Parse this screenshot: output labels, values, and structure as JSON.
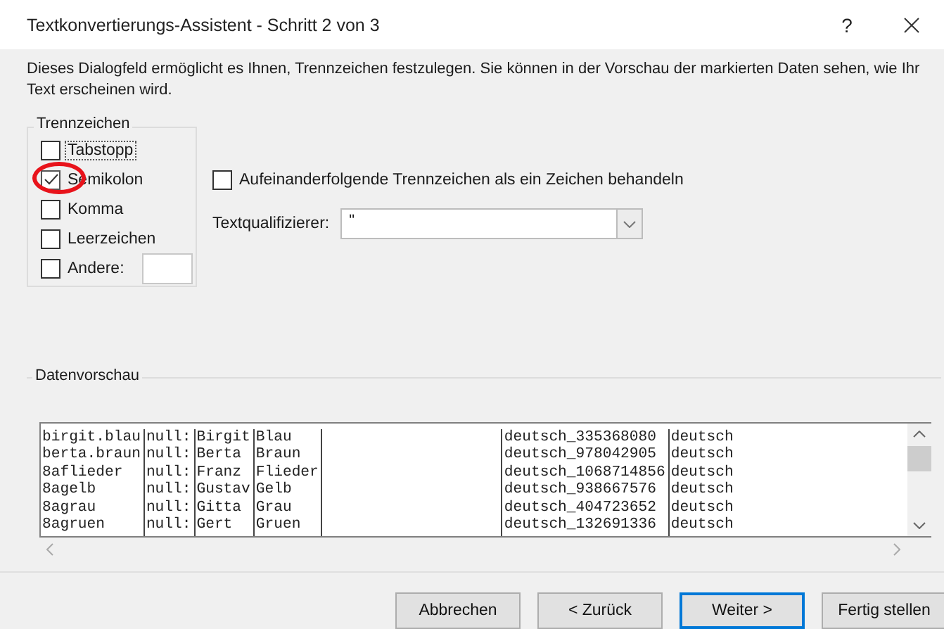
{
  "window": {
    "title": "Textkonvertierungs-Assistent - Schritt 2 von 3",
    "help": "?"
  },
  "description": "Dieses Dialogfeld ermöglicht es Ihnen, Trennzeichen festzulegen. Sie können in der Vorschau der markierten Daten sehen, wie Ihr Text erscheinen wird.",
  "delimiters": {
    "title": "Trennzeichen",
    "items": [
      {
        "label": "Tabstopp",
        "checked": false,
        "focused": true,
        "highlighted": false
      },
      {
        "label": "Semikolon",
        "checked": true,
        "focused": false,
        "highlighted": true
      },
      {
        "label": "Komma",
        "checked": false,
        "focused": false,
        "highlighted": false
      },
      {
        "label": "Leerzeichen",
        "checked": false,
        "focused": false,
        "highlighted": false
      },
      {
        "label": "Andere:",
        "checked": false,
        "focused": false,
        "highlighted": false,
        "kind": "with-field"
      }
    ]
  },
  "consecutive": {
    "label": "Aufeinanderfolgende Trennzeichen als ein Zeichen behandeln",
    "checked": false
  },
  "qualifier": {
    "label": "Textqualifizierer:",
    "value": "\""
  },
  "preview": {
    "title": "Datenvorschau",
    "columns": [
      {
        "kind": "text"
      },
      {
        "kind": "text"
      },
      {
        "kind": "text"
      },
      {
        "kind": "text"
      },
      {
        "kind": "blank"
      },
      {
        "kind": "text"
      },
      {
        "kind": "text"
      }
    ],
    "rows": [
      [
        "birgit.blau",
        "null:",
        "Birgit",
        "Blau",
        "deutsch_335368080",
        "deutsch"
      ],
      [
        "berta.braun",
        "null:",
        "Berta",
        "Braun",
        "deutsch_978042905",
        "deutsch"
      ],
      [
        "8aflieder",
        "null:",
        "Franz",
        "Flieder",
        "deutsch_1068714856",
        "deutsch"
      ],
      [
        "8agelb",
        "null:",
        "Gustav",
        "Gelb",
        "deutsch_938667576",
        "deutsch"
      ],
      [
        "8agrau",
        "null:",
        "Gitta",
        "Grau",
        "deutsch_404723652",
        "deutsch"
      ],
      [
        "8agruen",
        "null:",
        "Gert",
        "Gruen",
        "deutsch_132691336",
        "deutsch"
      ]
    ]
  },
  "buttons": [
    {
      "label": "Abbrechen",
      "default": false
    },
    {
      "label": "< Zurück",
      "default": false
    },
    {
      "label": "Weiter >",
      "default": true
    },
    {
      "label": "Fertig stellen",
      "default": false
    }
  ]
}
